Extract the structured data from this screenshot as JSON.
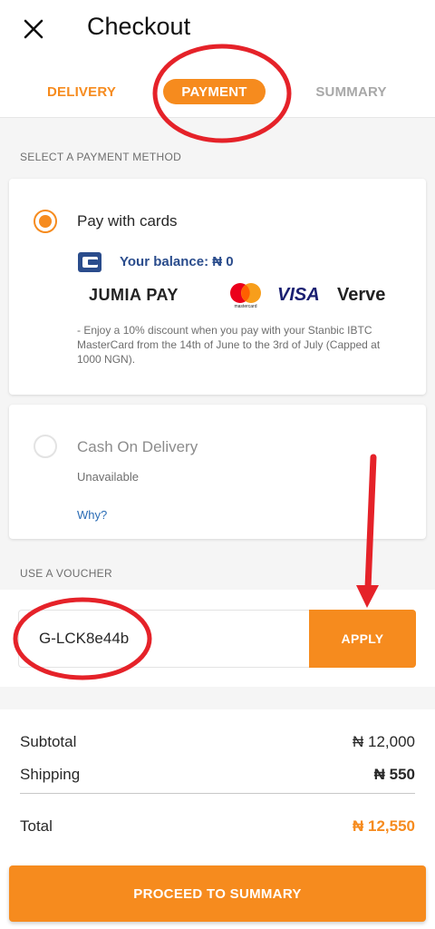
{
  "header": {
    "close_icon": "close-icon",
    "title": "Checkout",
    "tabs": [
      {
        "label": "DELIVERY",
        "state": "done"
      },
      {
        "label": "PAYMENT",
        "state": "active"
      },
      {
        "label": "SUMMARY",
        "state": "inactive"
      }
    ]
  },
  "payment": {
    "section_label": "SELECT A PAYMENT METHOD",
    "methods": [
      {
        "label": "Pay with cards",
        "selected": true,
        "wallet_icon": "wallet-icon",
        "balance_label": "Your balance: ₦ 0",
        "card_logos": [
          "JUMIA PAY",
          "Mastercard",
          "VISA",
          "Verve"
        ],
        "mastercard_caption": "mastercard",
        "promo": "- Enjoy a 10% discount when you pay with your Stanbic IBTC MasterCard from the 14th of June to the 3rd of July (Capped at 1000 NGN)."
      },
      {
        "label": "Cash On Delivery",
        "selected": false,
        "status": "Unavailable",
        "link": "Why?"
      }
    ]
  },
  "voucher": {
    "section_label": "USE A VOUCHER",
    "input_value": "G-LCK8e44b",
    "apply_label": "APPLY"
  },
  "totals": {
    "subtotal_label": "Subtotal",
    "subtotal_value": "₦ 12,000",
    "shipping_label": "Shipping",
    "shipping_value": "₦ 550",
    "total_label": "Total",
    "total_value": "₦ 12,550"
  },
  "proceed_label": "PROCEED TO SUMMARY",
  "colors": {
    "accent": "#f68b1e",
    "link": "#2a6cb5",
    "balance": "#2a4c8c",
    "annotation": "#e52229"
  }
}
